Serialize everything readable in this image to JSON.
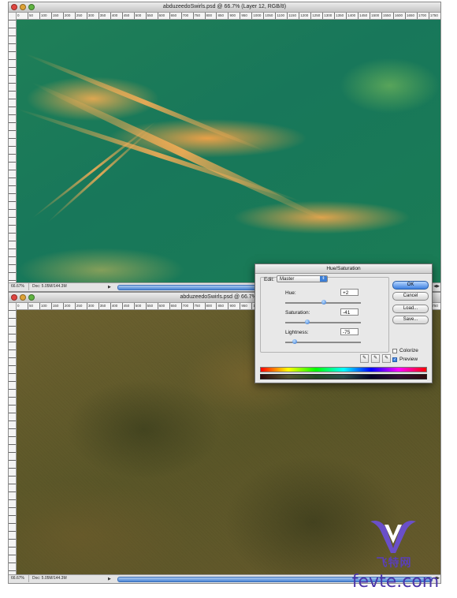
{
  "window1": {
    "title": "abduzeedoSwirls.psd @ 66.7% (Layer 12, RGB/8)",
    "ruler_ticks": [
      "0",
      "50",
      "100",
      "150",
      "200",
      "250",
      "300",
      "350",
      "400",
      "450",
      "500",
      "550",
      "600",
      "650",
      "700",
      "750",
      "800",
      "850",
      "900",
      "950",
      "1000",
      "1050",
      "1100",
      "1150",
      "1200",
      "1250",
      "1300",
      "1350",
      "1400",
      "1450",
      "1500",
      "1550",
      "1600",
      "1650",
      "1700",
      "1750"
    ],
    "zoom": "66.67%",
    "doc_info": "Doc: 5.05M/144.3M"
  },
  "window2": {
    "title": "abduzeedoSwirls.psd @ 66.7% (Lay",
    "zoom": "66.67%",
    "doc_info": "Doc: 5.05M/144.3M"
  },
  "dialog": {
    "title": "Hue/Saturation",
    "edit_label": "Edit:",
    "edit_value": "Master",
    "hue_label": "Hue:",
    "hue_value": "+2",
    "hue_level": 0.51,
    "saturation_label": "Saturation:",
    "saturation_value": "-41",
    "saturation_level": 0.29,
    "lightness_label": "Lightness:",
    "lightness_value": "-75",
    "lightness_level": 0.125,
    "ok_label": "OK",
    "cancel_label": "Cancel",
    "load_label": "Load...",
    "save_label": "Save...",
    "colorize_label": "Colorize",
    "colorize_checked": false,
    "preview_label": "Preview",
    "preview_checked": true
  },
  "watermark": {
    "cn_text": "飞特网",
    "url": "fevte.com"
  }
}
